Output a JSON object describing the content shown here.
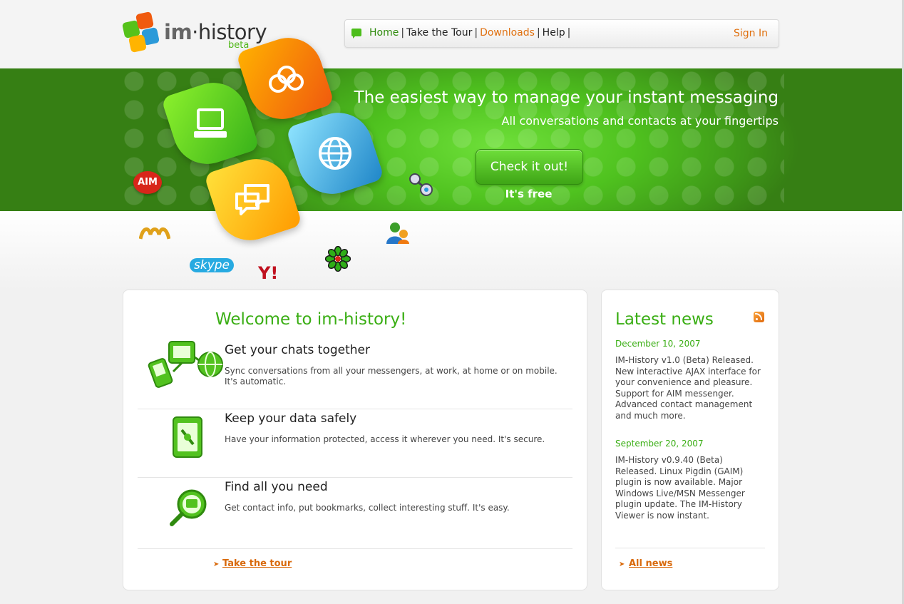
{
  "logo": {
    "brand_im": "im",
    "brand_dot": "·",
    "brand_history": "history",
    "beta": "beta"
  },
  "nav": {
    "items": [
      "Home",
      "Take the Tour",
      "Downloads",
      "Help"
    ],
    "separator": "|",
    "sign_in": "Sign In"
  },
  "hero": {
    "title": "The easiest way to manage your instant messaging",
    "subtitle": "All conversations and contacts at your fingertips",
    "cta": "Check it out!",
    "cta_note": "It's free"
  },
  "messengers": {
    "aim": "AIM",
    "yahoo": "Y!",
    "skype": "skype"
  },
  "welcome": {
    "title": "Welcome to im-history!",
    "features": [
      {
        "title": "Get your chats together",
        "desc": "Sync conversations from all your messengers, at work, at home or on mobile. It's automatic."
      },
      {
        "title": "Keep your data safely",
        "desc": "Have your information protected, access it wherever you need. It's secure."
      },
      {
        "title": "Find all you need",
        "desc": "Get contact info, put bookmarks, collect interesting stuff. It's easy."
      }
    ],
    "link": "Take the tour"
  },
  "news": {
    "title": "Latest news",
    "items": [
      {
        "date": "December 10, 2007",
        "text": "IM-History v1.0 (Beta) Released. New interactive AJAX interface for your convenience and pleasure. Support for AIM messenger. Advanced contact management and much more."
      },
      {
        "date": "September 20, 2007",
        "text": "IM-History v0.9.40 (Beta) Released. Linux Pigdin (GAIM) plugin is now available. Major Windows Live/MSN Messenger plugin update. The IM-History Viewer is now instant."
      }
    ],
    "link": "All news"
  },
  "colors": {
    "brand_green": "#3aae14",
    "accent_orange": "#e0700f",
    "hero_green": "#4fc21f"
  },
  "icons": [
    "logo-mark-icon",
    "chat-bubble-icon",
    "computer-icon",
    "people-icon",
    "globe-icon",
    "speech-bubbles-icon",
    "rss-icon",
    "devices-icon",
    "phone-lock-icon",
    "magnifier-icon",
    "arrow-right-icon"
  ]
}
